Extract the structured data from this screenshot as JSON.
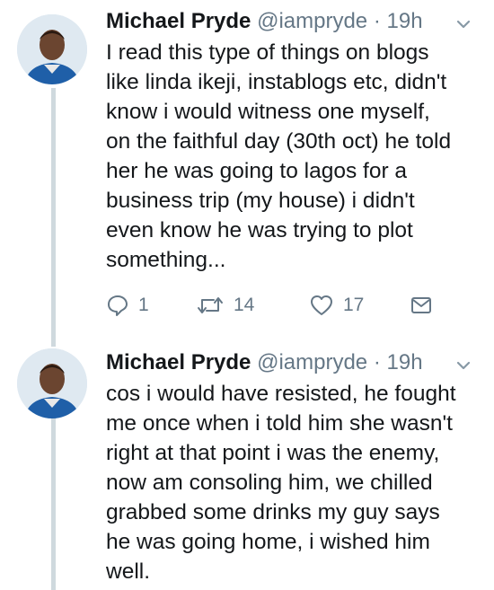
{
  "tweets": [
    {
      "name": "Michael Pryde",
      "handle": "@iampryde",
      "separator": "·",
      "time": "19h",
      "text": "I read this type of things on blogs\nlike linda ikeji, instablogs etc, didn't\nknow i would witness one myself,\non the faithful day (30th oct) he told\nher he was going to lagos for a\nbusiness trip (my house) i didn't\neven know he was trying to plot\nsomething...",
      "replies": "1",
      "retweets": "14",
      "likes": "17"
    },
    {
      "name": "Michael Pryde",
      "handle": "@iampryde",
      "separator": "·",
      "time": "19h",
      "text": "cos i would have resisted, he fought\nme once when i told him she wasn't\nright at that point i was the enemy,\nnow am consoling him, we chilled\ngrabbed some drinks my guy says\nhe was going home, i wished him\nwell."
    }
  ],
  "icons": {
    "reply": "reply-icon",
    "retweet": "retweet-icon",
    "like": "heart-icon",
    "dm": "envelope-icon",
    "menu": "chevron-down-icon"
  },
  "colors": {
    "text": "#14171a",
    "secondary": "#657786",
    "thread_line": "#cfd9de"
  }
}
